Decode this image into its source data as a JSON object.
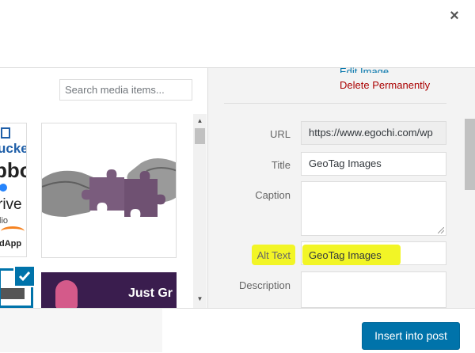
{
  "modal": {
    "close_label": "×"
  },
  "library": {
    "search_placeholder": "Search media items...",
    "logo_tile_text": [
      "ucke",
      "pbo",
      "rive",
      "lio",
      "dApp"
    ],
    "banner_text": "Just Gr"
  },
  "details": {
    "edit_link": "Edit Image",
    "delete_link": "Delete Permanently",
    "url_label": "URL",
    "url_value": "https://www.egochi.com/wp",
    "title_label": "Title",
    "title_value": "GeoTag Images",
    "caption_label": "Caption",
    "alt_label": "Alt Text",
    "alt_value": "GeoTag Images",
    "description_label": "Description"
  },
  "toolbar": {
    "insert_label": "Insert into post"
  },
  "colors": {
    "primary": "#0073aa",
    "link": "#0073aa",
    "delete": "#a00",
    "highlight": "#f2f526"
  }
}
